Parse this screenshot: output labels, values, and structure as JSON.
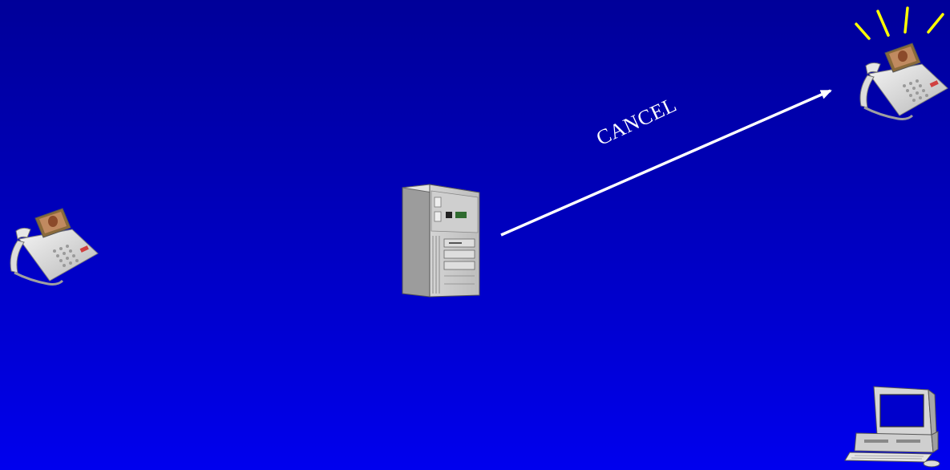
{
  "message": {
    "label": "CANCEL",
    "arrow_color": "#ffffff"
  },
  "nodes": [
    {
      "role": "caller-phone",
      "icon": "video-phone-icon"
    },
    {
      "role": "proxy-server",
      "icon": "server-tower-icon"
    },
    {
      "role": "callee-phone",
      "icon": "video-phone-icon",
      "state": "ringing"
    },
    {
      "role": "desktop-computer",
      "icon": "desktop-computer-icon"
    }
  ],
  "colors": {
    "background_top": "#000099",
    "background_bottom": "#0000ee",
    "ring_lines": "#ffff00",
    "message_text": "#ffffff"
  }
}
